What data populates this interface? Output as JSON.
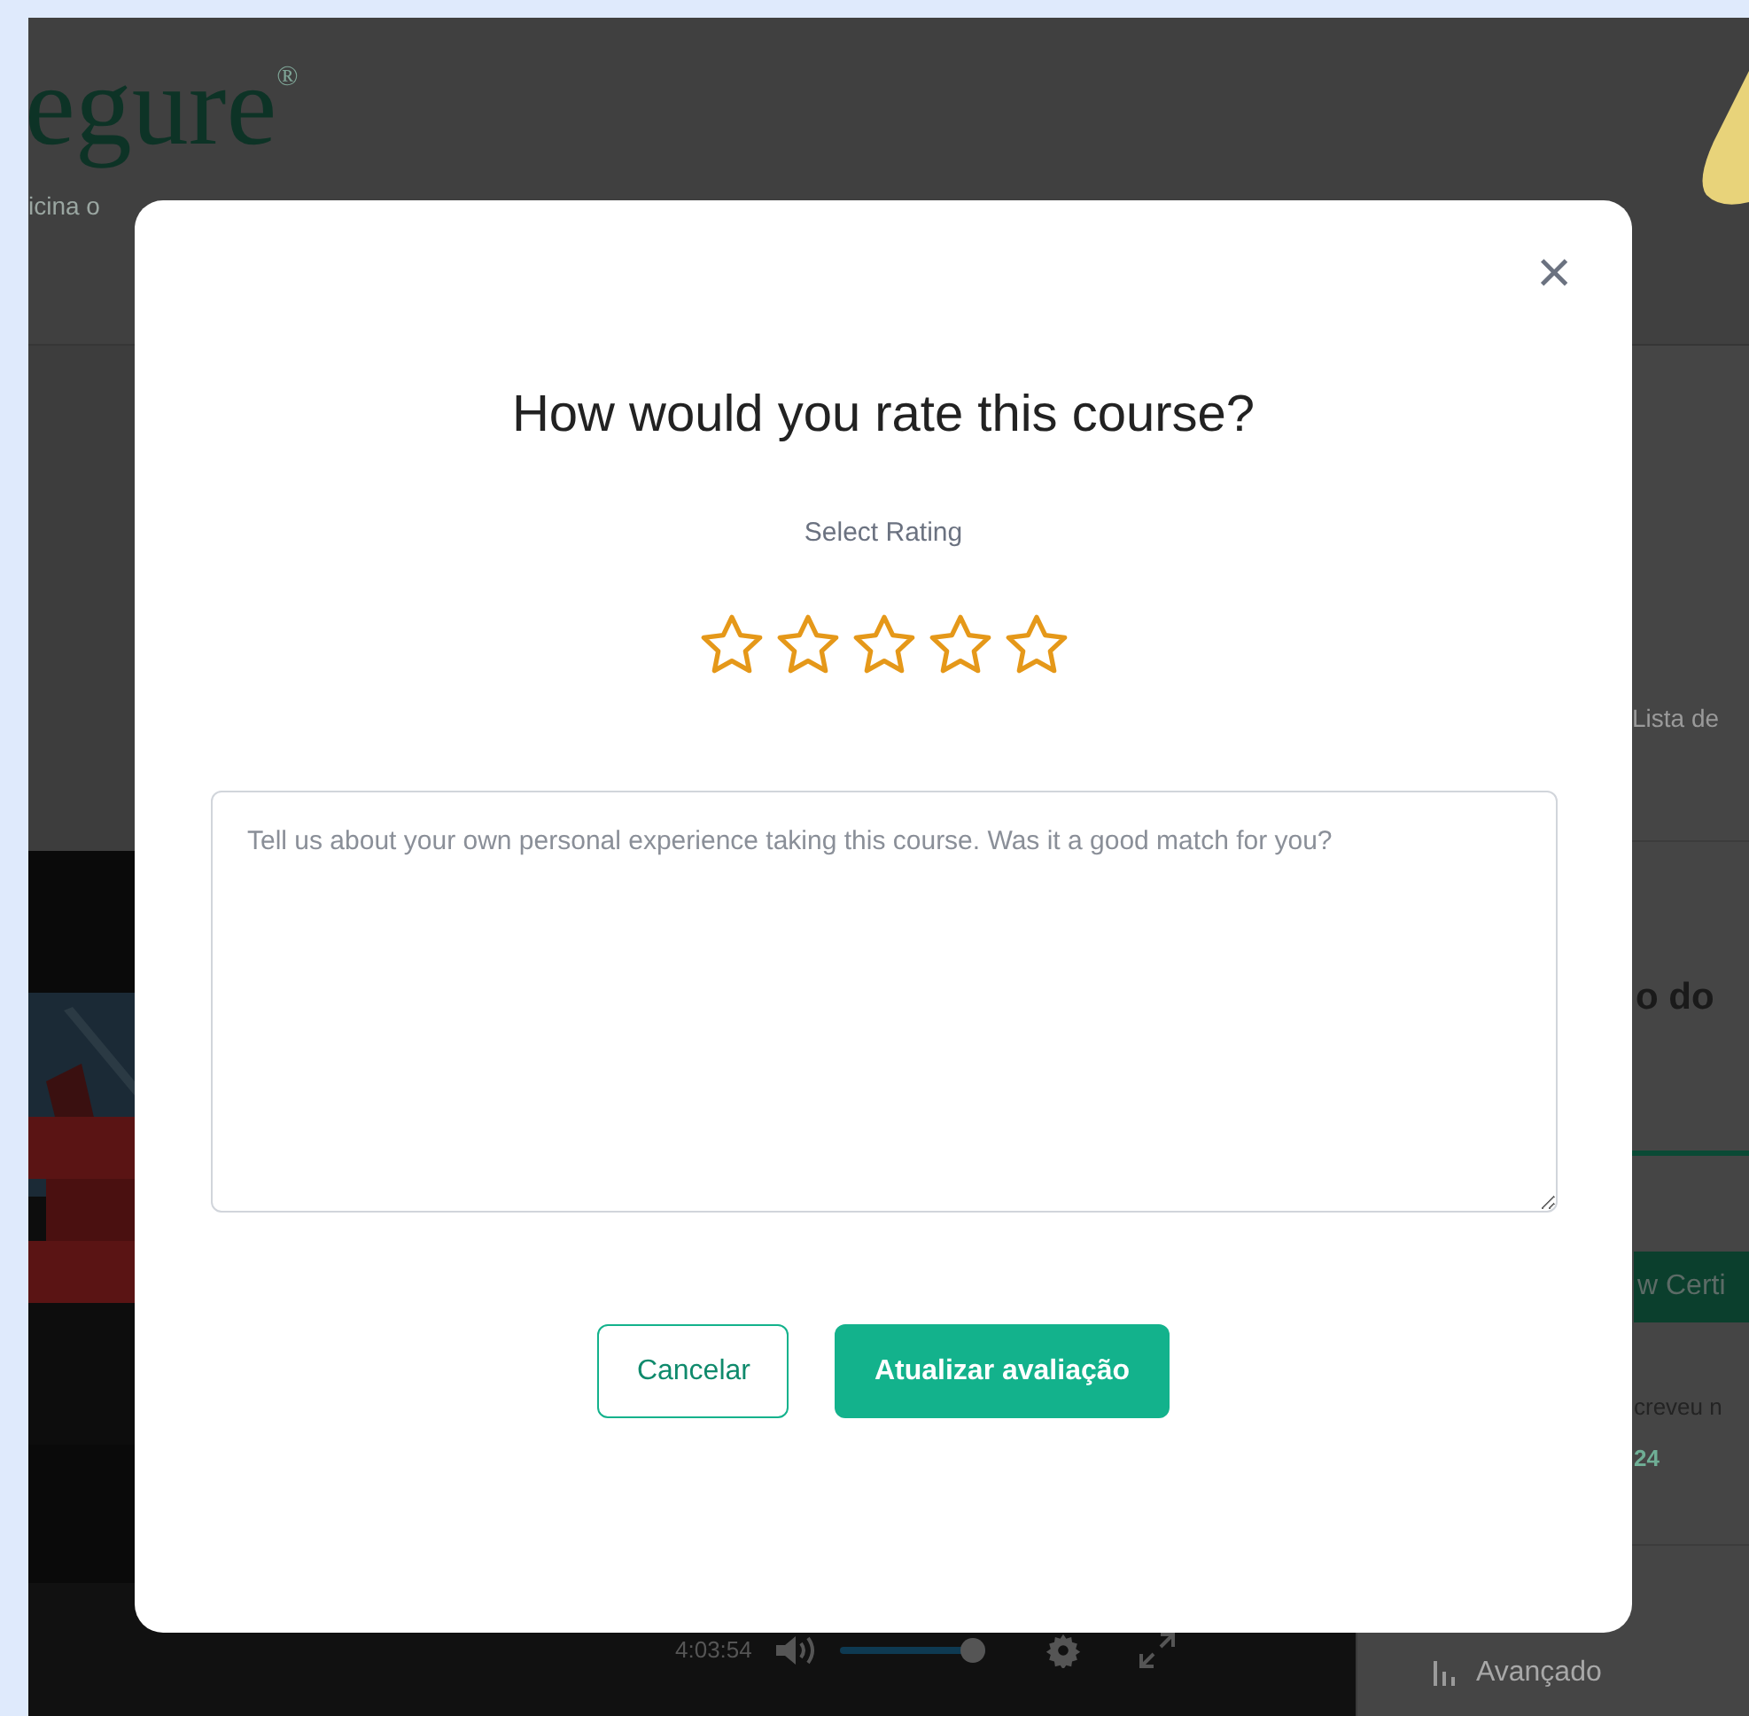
{
  "background": {
    "logo": "egure",
    "logo_mark": "®",
    "tagline": "icina o",
    "side_panel": {
      "link": "Lista de",
      "heading": "o do",
      "certificate_button": "w Certi",
      "enrolled_text": "creveu n",
      "date": "24",
      "menu_item": "Avançado"
    },
    "player": {
      "time": "4:03:54",
      "volume": {
        "level": 0.97
      }
    }
  },
  "dialog": {
    "close": "×",
    "title": "How would you rate this course?",
    "subtitle": "Select Rating",
    "rating": {
      "stars": 0
    },
    "review": {
      "placeholder": "Tell us about your own personal experience taking this course. Was it a good match for you?"
    },
    "buttons": [
      {
        "label": "Cancelar",
        "kind": "secondary"
      },
      {
        "label": "Atualizar avaliação",
        "kind": "primary"
      }
    ]
  }
}
